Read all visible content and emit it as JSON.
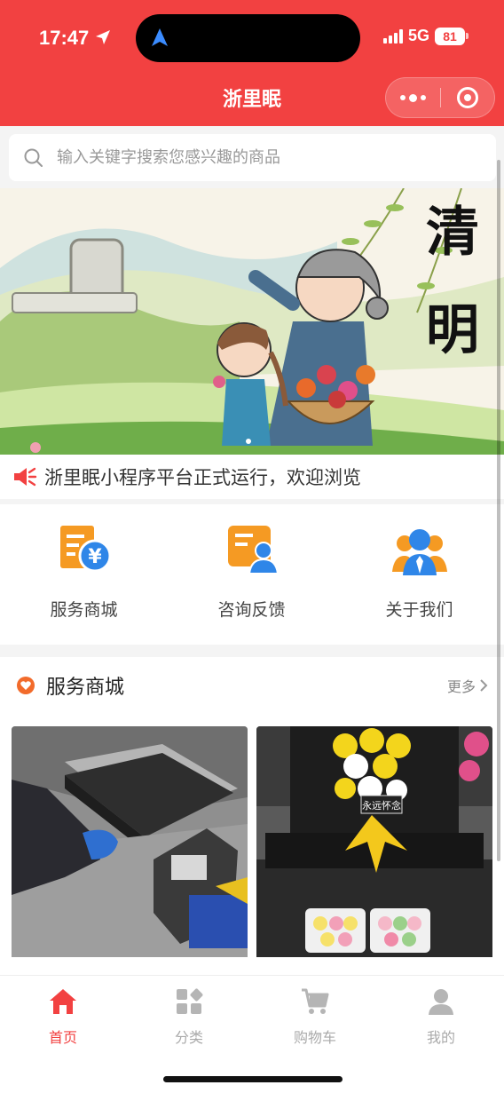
{
  "status_bar": {
    "time": "17:47",
    "network": "5G",
    "battery": "81"
  },
  "nav": {
    "title": "浙里眠"
  },
  "search": {
    "placeholder": "输入关键字搜索您感兴趣的商品"
  },
  "banner": {
    "caption_line1": "清",
    "caption_line2": "明"
  },
  "notice": {
    "text": "浙里眠小程序平台正式运行，欢迎浏览"
  },
  "quick_menu": [
    {
      "label": "服务商城",
      "icon": "shop-yen-icon"
    },
    {
      "label": "咨询反馈",
      "icon": "consult-icon"
    },
    {
      "label": "关于我们",
      "icon": "about-us-icon"
    }
  ],
  "section": {
    "title": "服务商城",
    "more": "更多"
  },
  "products": [
    {
      "image": "tomb-cleaning-photo"
    },
    {
      "image": "tomb-flowers-photo",
      "wreath_text": "永远怀念"
    }
  ],
  "tabbar": [
    {
      "label": "首页",
      "icon": "home-icon",
      "active": true
    },
    {
      "label": "分类",
      "icon": "category-icon",
      "active": false
    },
    {
      "label": "购物车",
      "icon": "cart-icon",
      "active": false
    },
    {
      "label": "我的",
      "icon": "user-icon",
      "active": false
    }
  ],
  "colors": {
    "brand": "#f24141",
    "icon_orange": "#f59a23",
    "icon_blue": "#2f86e8"
  }
}
